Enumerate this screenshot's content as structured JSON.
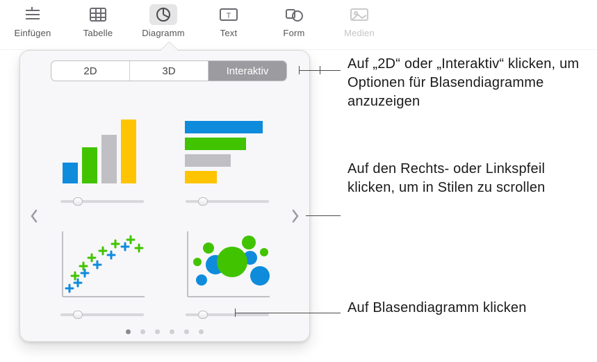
{
  "toolbar": {
    "items": [
      {
        "label": "Einfügen",
        "icon": "insert-icon"
      },
      {
        "label": "Tabelle",
        "icon": "table-icon"
      },
      {
        "label": "Diagramm",
        "icon": "chart-pie-icon",
        "selected": true
      },
      {
        "label": "Text",
        "icon": "text-box-icon"
      },
      {
        "label": "Form",
        "icon": "shape-icon"
      },
      {
        "label": "Medien",
        "icon": "media-icon"
      }
    ]
  },
  "popover": {
    "tabs": {
      "t2d": "2D",
      "t3d": "3D",
      "inter": "Interaktiv",
      "active_index": 2
    },
    "thumbs": [
      "column-chart",
      "horizontal-bar-chart",
      "scatter-chart",
      "bubble-chart"
    ],
    "page_count": 6,
    "page_active": 0
  },
  "callouts": {
    "tabs": "Auf „2D“ oder „Interaktiv“ klicken, um Optionen für Blasendiagramme anzuzeigen",
    "arrows": "Auf den Rechts- oder Linkspfeil klicken, um in Stilen zu scrollen",
    "bubble": "Auf Blasendiagramm klicken"
  },
  "colors": {
    "blue": "#0f8bdc",
    "green": "#41c300",
    "yellow": "#ffc400",
    "grey": "#bfbfc4"
  }
}
